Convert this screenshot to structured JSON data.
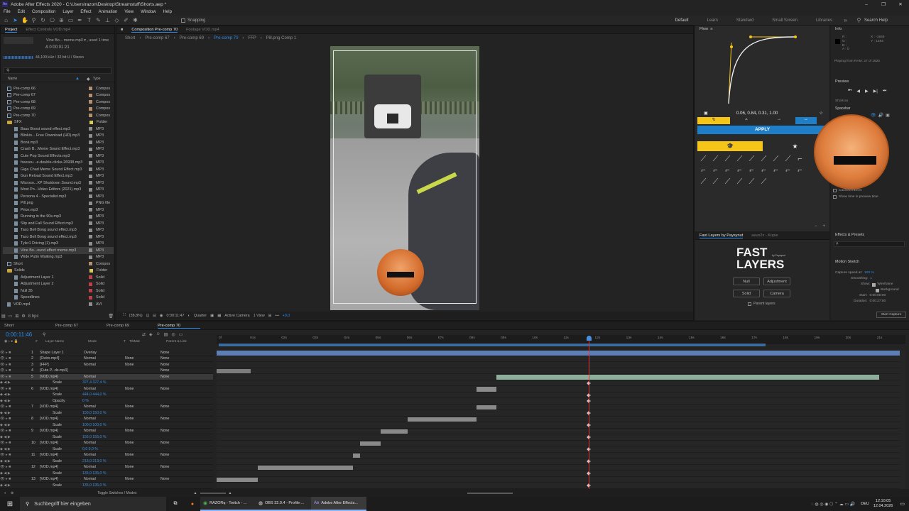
{
  "window": {
    "title": "Adobe After Effects 2020 - C:\\Users\\razon\\Desktop\\Streamstuff\\Shorts.aep *",
    "controls": [
      "–",
      "❐",
      "✕"
    ]
  },
  "menu": [
    "File",
    "Edit",
    "Composition",
    "Layer",
    "Effect",
    "Animation",
    "View",
    "Window",
    "Help"
  ],
  "toolbar": {
    "snapping": "Snapping",
    "workspaces": [
      "Default",
      "Learn",
      "Standard",
      "Small Screen",
      "Libraries"
    ],
    "search_help": "Search Help"
  },
  "project": {
    "tabs": [
      "Project",
      "Effect Controls VOD.mp4"
    ],
    "selected_name": "Vine Bo... meme.mp3 ▾ , used 1 time",
    "duration": "Δ 0:00:01:21",
    "audio_info": "44,100 kHz / 32 bit U / Stereo",
    "search_icon": "search-icon",
    "col_name": "Name",
    "col_type": "Type",
    "items": [
      {
        "name": "Pre-comp 66",
        "type": "Compos",
        "kind": "comp",
        "indent": 0,
        "swatch": "#b38f6f"
      },
      {
        "name": "Pre-comp 67",
        "type": "Compos",
        "kind": "comp",
        "indent": 0,
        "swatch": "#b38f6f"
      },
      {
        "name": "Pre-comp 68",
        "type": "Compos",
        "kind": "comp",
        "indent": 0,
        "swatch": "#b38f6f"
      },
      {
        "name": "Pre-comp 69",
        "type": "Compos",
        "kind": "comp",
        "indent": 0,
        "swatch": "#b38f6f"
      },
      {
        "name": "Pre-comp 70",
        "type": "Compos",
        "kind": "comp",
        "indent": 0,
        "swatch": "#b38f6f"
      },
      {
        "name": "SFX",
        "type": "Folder",
        "kind": "folder",
        "indent": 0,
        "swatch": "#d9c85a"
      },
      {
        "name": "Bass Boost sound effect.mp3",
        "type": "MP3",
        "kind": "media",
        "indent": 1,
        "swatch": "#8f8f8f"
      },
      {
        "name": "Blinkin... Free Download (HD).mp3",
        "type": "MP3",
        "kind": "media",
        "indent": 1,
        "swatch": "#8f8f8f"
      },
      {
        "name": "Bonk.mp3",
        "type": "MP3",
        "kind": "media",
        "indent": 1,
        "swatch": "#8f8f8f"
      },
      {
        "name": "Crash B...Meme Sound Effect.mp3",
        "type": "MP3",
        "kind": "media",
        "indent": 1,
        "swatch": "#8f8f8f"
      },
      {
        "name": "Cute Pop Sound Effects.mp3",
        "type": "MP3",
        "kind": "media",
        "indent": 1,
        "swatch": "#8f8f8f"
      },
      {
        "name": "freesou...e-double-clicks-26938.mp3",
        "type": "MP3",
        "kind": "media",
        "indent": 1,
        "swatch": "#8f8f8f"
      },
      {
        "name": "Giga Chad Meme Sound Effect.mp3",
        "type": "MP3",
        "kind": "media",
        "indent": 1,
        "swatch": "#8f8f8f"
      },
      {
        "name": "Gun Reload Sound Effect.mp3",
        "type": "MP3",
        "kind": "media",
        "indent": 1,
        "swatch": "#8f8f8f"
      },
      {
        "name": "Microso...XP Shutdown Sound.mp3",
        "type": "MP3",
        "kind": "media",
        "indent": 1,
        "swatch": "#8f8f8f"
      },
      {
        "name": "Most Po...Video Editors (2021).mp3",
        "type": "MP3",
        "kind": "media",
        "indent": 1,
        "swatch": "#8f8f8f"
      },
      {
        "name": "Persona 4 - Specialist.mp3",
        "type": "MP3",
        "kind": "media",
        "indent": 1,
        "swatch": "#8f8f8f"
      },
      {
        "name": "Pill.png",
        "type": "PNG file",
        "kind": "media",
        "indent": 1,
        "swatch": "#8f8f8f"
      },
      {
        "name": "Price.mp3",
        "type": "MP3",
        "kind": "media",
        "indent": 1,
        "swatch": "#8f8f8f"
      },
      {
        "name": "Running in the 90s.mp3",
        "type": "MP3",
        "kind": "media",
        "indent": 1,
        "swatch": "#8f8f8f"
      },
      {
        "name": "Slip and Fall Sound Effect.mp3",
        "type": "MP3",
        "kind": "media",
        "indent": 1,
        "swatch": "#8f8f8f"
      },
      {
        "name": "Taco Bell Bong sound effect.mp3",
        "type": "MP3",
        "kind": "media",
        "indent": 1,
        "swatch": "#8f8f8f"
      },
      {
        "name": "Taco Bell Bong sound effect.mp3",
        "type": "MP3",
        "kind": "media",
        "indent": 1,
        "swatch": "#8f8f8f"
      },
      {
        "name": "Tyler1 Driving (1).mp3",
        "type": "MP3",
        "kind": "media",
        "indent": 1,
        "swatch": "#8f8f8f"
      },
      {
        "name": "Vine Bo...ound effect meme.mp3",
        "type": "MP3",
        "kind": "media",
        "indent": 1,
        "swatch": "#8f8f8f",
        "selected": true
      },
      {
        "name": "Wide Putin Walking.mp3",
        "type": "MP3",
        "kind": "media",
        "indent": 1,
        "swatch": "#8f8f8f"
      },
      {
        "name": "Short",
        "type": "Compos",
        "kind": "comp",
        "indent": 0,
        "swatch": "#b38f6f"
      },
      {
        "name": "Solids",
        "type": "Folder",
        "kind": "folder",
        "indent": 0,
        "swatch": "#d9c85a"
      },
      {
        "name": "Adjustment Layer 1",
        "type": "Solid",
        "kind": "media",
        "indent": 1,
        "swatch": "#c0404a"
      },
      {
        "name": "Adjustment Layer 2",
        "type": "Solid",
        "kind": "media",
        "indent": 1,
        "swatch": "#c0404a"
      },
      {
        "name": "Null 35",
        "type": "Solid",
        "kind": "media",
        "indent": 1,
        "swatch": "#c0404a"
      },
      {
        "name": "Speedlines",
        "type": "Solid",
        "kind": "media",
        "indent": 1,
        "swatch": "#c0404a"
      },
      {
        "name": "VOD.mp4",
        "type": "AVI",
        "kind": "media",
        "indent": 0,
        "swatch": "#8f8f8f"
      }
    ],
    "footer_bpc": "8 bpc"
  },
  "composition": {
    "tabs": [
      "Composition Pre-comp 70",
      "Footage VOD.mp4"
    ],
    "breadcrumbs": [
      "Short",
      "Pre-comp 67",
      "Pre-comp 69",
      "Pre-comp 70",
      "FFP",
      "Pill.png Comp 1"
    ],
    "zoom": "(38,8%)",
    "timecode": "0:00:11:47",
    "resolution": "Quarter",
    "camera": "Active Camera",
    "views": "1 View",
    "exposure": "+0,0"
  },
  "flow": {
    "title": "Flow",
    "bezier": "0.06, 0.84, 0.31, 1.00",
    "apply": "APPLY",
    "accent": "#f5c518",
    "apply_color": "#1e7fc8"
  },
  "fast_layers": {
    "tabs": [
      "Fast Layers by Paysynut",
      "aeux2x - Kopie"
    ],
    "logo_line1": "FAST",
    "logo_line2": "LAYERS",
    "logo_small": "by Paysynut",
    "buttons": [
      "Null",
      "Adjustment",
      "Solid",
      "Camera"
    ],
    "checkbox": "Parent layers"
  },
  "info": {
    "title": "Info",
    "r": "R :",
    "g": "G :",
    "b": "B :",
    "a": "A : 0",
    "x": "X : -1549",
    "y": "Y : 1283",
    "playing": "Playing from RAM: 27 of 1620",
    "preview_title": "Preview",
    "shortcut": "Shortcut",
    "spacebar": "Spacebar",
    "cached_frames": "Cached frames",
    "show_time": "Show time in preview time",
    "effects_title": "Effects & Presets",
    "motion_sketch": "Motion Sketch",
    "capture_speed": "Capture speed at:",
    "capture_speed_val": "100 %",
    "smoothing": "Smoothing:",
    "smoothing_val": "1",
    "show": "Show:",
    "wireframe": "Wireframe",
    "background": "Background",
    "start": "Start:",
    "start_val": "0:00:00:00",
    "duration": "Duration:",
    "duration_val": "0:00:27:00",
    "start_capture": "Start Capture"
  },
  "timeline": {
    "tabs": [
      "Short",
      "Pre-comp 67",
      "Pre-comp 69",
      "Pre-comp 70"
    ],
    "timecode": "0:00:11:46",
    "headers": [
      "#",
      "Layer Name",
      "Mode",
      "T",
      "TrkMat",
      "Parent & Link"
    ],
    "ruler": [
      "0f",
      "01s",
      "02s",
      "03s",
      "04s",
      "05s",
      "06s",
      "07s",
      "08s",
      "09s",
      "10s",
      "11s",
      "12s",
      "13s",
      "14s",
      "15s",
      "16s",
      "17s",
      "18s",
      "19s",
      "20s",
      "21s"
    ],
    "toggle": "Toggle Switches / Modes",
    "rows": [
      {
        "num": "1",
        "name": "Shape Layer 1",
        "mode": "Overlay",
        "trk": "",
        "parent": "None",
        "color": "#5d7fb5",
        "start": 0.0,
        "end": 1.0
      },
      {
        "num": "2",
        "name": "[Outro.mp4]",
        "mode": "Normal",
        "trk": "None",
        "parent": "None",
        "color": "#6a6a6a",
        "start": 0.0,
        "end": 0.0
      },
      {
        "num": "3",
        "name": "[FFP]",
        "mode": "Normal",
        "trk": "None",
        "parent": "None",
        "color": "#6a6a6a",
        "start": 0.0,
        "end": 0.0
      },
      {
        "num": "4",
        "name": "[Cute P...ds.mp3]",
        "mode": "",
        "trk": "",
        "parent": "None",
        "color": "#7d7d7d",
        "start": 0.0,
        "end": 0.05
      },
      {
        "num": "5",
        "name": "[VOD.mp4]",
        "mode": "Normal",
        "trk": "",
        "parent": "None",
        "color": "#8cae9a",
        "start": 0.41,
        "end": 0.97,
        "selected": true
      },
      {
        "num": "",
        "name": "Scale",
        "mode": "327,4 327,4 %",
        "trk": "",
        "parent": "",
        "color": "",
        "start": 0,
        "end": 0,
        "prop": true
      },
      {
        "num": "6",
        "name": "[VOD.mp4]",
        "mode": "Normal",
        "trk": "None",
        "parent": "None",
        "color": "#8a8a8a",
        "start": 0.38,
        "end": 0.41
      },
      {
        "num": "",
        "name": "Scale",
        "mode": "444,0 444,0 %",
        "trk": "",
        "parent": "",
        "color": "",
        "start": 0,
        "end": 0,
        "prop": true
      },
      {
        "num": "",
        "name": "Opacity",
        "mode": "0 %",
        "trk": "",
        "parent": "",
        "color": "",
        "start": 0,
        "end": 0,
        "prop": true
      },
      {
        "num": "7",
        "name": "[VOD.mp4]",
        "mode": "Normal",
        "trk": "None",
        "parent": "None",
        "color": "#8a8a8a",
        "start": 0.38,
        "end": 0.41
      },
      {
        "num": "",
        "name": "Scale",
        "mode": "150,0 150,0 %",
        "trk": "",
        "parent": "",
        "color": "",
        "start": 0,
        "end": 0,
        "prop": true
      },
      {
        "num": "8",
        "name": "[VOD.mp4]",
        "mode": "Normal",
        "trk": "None",
        "parent": "None",
        "color": "#8a8a8a",
        "start": 0.28,
        "end": 0.38
      },
      {
        "num": "",
        "name": "Scale",
        "mode": "100,0 100,0 %",
        "trk": "",
        "parent": "",
        "color": "",
        "start": 0,
        "end": 0,
        "prop": true
      },
      {
        "num": "9",
        "name": "[VOD.mp4]",
        "mode": "Normal",
        "trk": "None",
        "parent": "None",
        "color": "#8a8a8a",
        "start": 0.24,
        "end": 0.28
      },
      {
        "num": "",
        "name": "Scale",
        "mode": "155,0 155,0 %",
        "trk": "",
        "parent": "",
        "color": "",
        "start": 0,
        "end": 0,
        "prop": true
      },
      {
        "num": "10",
        "name": "[VOD.mp4]",
        "mode": "Normal",
        "trk": "None",
        "parent": "None",
        "color": "#8a8a8a",
        "start": 0.21,
        "end": 0.24
      },
      {
        "num": "",
        "name": "Scale",
        "mode": "0,0 0,0 %",
        "trk": "",
        "parent": "",
        "color": "",
        "start": 0,
        "end": 0,
        "prop": true
      },
      {
        "num": "11",
        "name": "[VOD.mp4]",
        "mode": "Normal",
        "trk": "None",
        "parent": "None",
        "color": "#8a8a8a",
        "start": 0.2,
        "end": 0.21
      },
      {
        "num": "",
        "name": "Scale",
        "mode": "213,0 213,0 %",
        "trk": "",
        "parent": "",
        "color": "",
        "start": 0,
        "end": 0,
        "prop": true
      },
      {
        "num": "12",
        "name": "[VOD.mp4]",
        "mode": "Normal",
        "trk": "None",
        "parent": "None",
        "color": "#8a8a8a",
        "start": 0.06,
        "end": 0.2
      },
      {
        "num": "",
        "name": "Scale",
        "mode": "135,0 135,0 %",
        "trk": "",
        "parent": "",
        "color": "",
        "start": 0,
        "end": 0,
        "prop": true
      },
      {
        "num": "13",
        "name": "[VOD.mp4]",
        "mode": "Normal",
        "trk": "None",
        "parent": "None",
        "color": "#8a8a8a",
        "start": 0.0,
        "end": 0.06
      },
      {
        "num": "",
        "name": "Scale",
        "mode": "135,0 135,0 %",
        "trk": "",
        "parent": "",
        "color": "",
        "start": 0,
        "end": 0,
        "prop": true
      }
    ],
    "playhead_fraction": 0.545,
    "work_area_end_fraction": 0.8
  },
  "taskbar": {
    "search": "Suchbegriff hier eingeben",
    "apps": [
      "RAZORq - Twitch - ...",
      "OBS 32.0.4 - Profile:...",
      "Adobe After Effects..."
    ],
    "lang": "DEU",
    "time": "12:10:05",
    "date": "12.04.2026"
  }
}
